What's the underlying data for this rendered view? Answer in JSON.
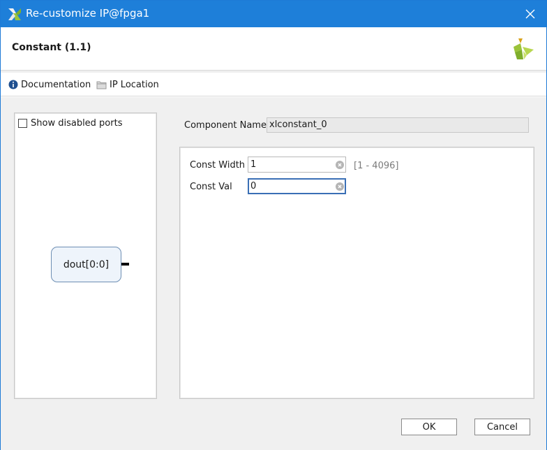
{
  "window": {
    "title": "Re-customize IP@fpga1",
    "accent": "#1e7fd9"
  },
  "header": {
    "ip_title": "Constant (1.1)",
    "logo": "xilinx-logo"
  },
  "toolbar": {
    "documentation_label": "Documentation",
    "ip_location_label": "IP Location"
  },
  "left_panel": {
    "show_disabled_ports_label": "Show disabled ports",
    "show_disabled_ports_checked": false,
    "block_port_label": "dout[0:0]"
  },
  "component": {
    "label": "Component Name",
    "value": "xlconstant_0"
  },
  "params": [
    {
      "label": "Const Width",
      "value": "1",
      "range": "[1 - 4096]"
    },
    {
      "label": "Const Val",
      "value": "0"
    }
  ],
  "buttons": {
    "ok_label": "OK",
    "cancel_label": "Cancel"
  }
}
